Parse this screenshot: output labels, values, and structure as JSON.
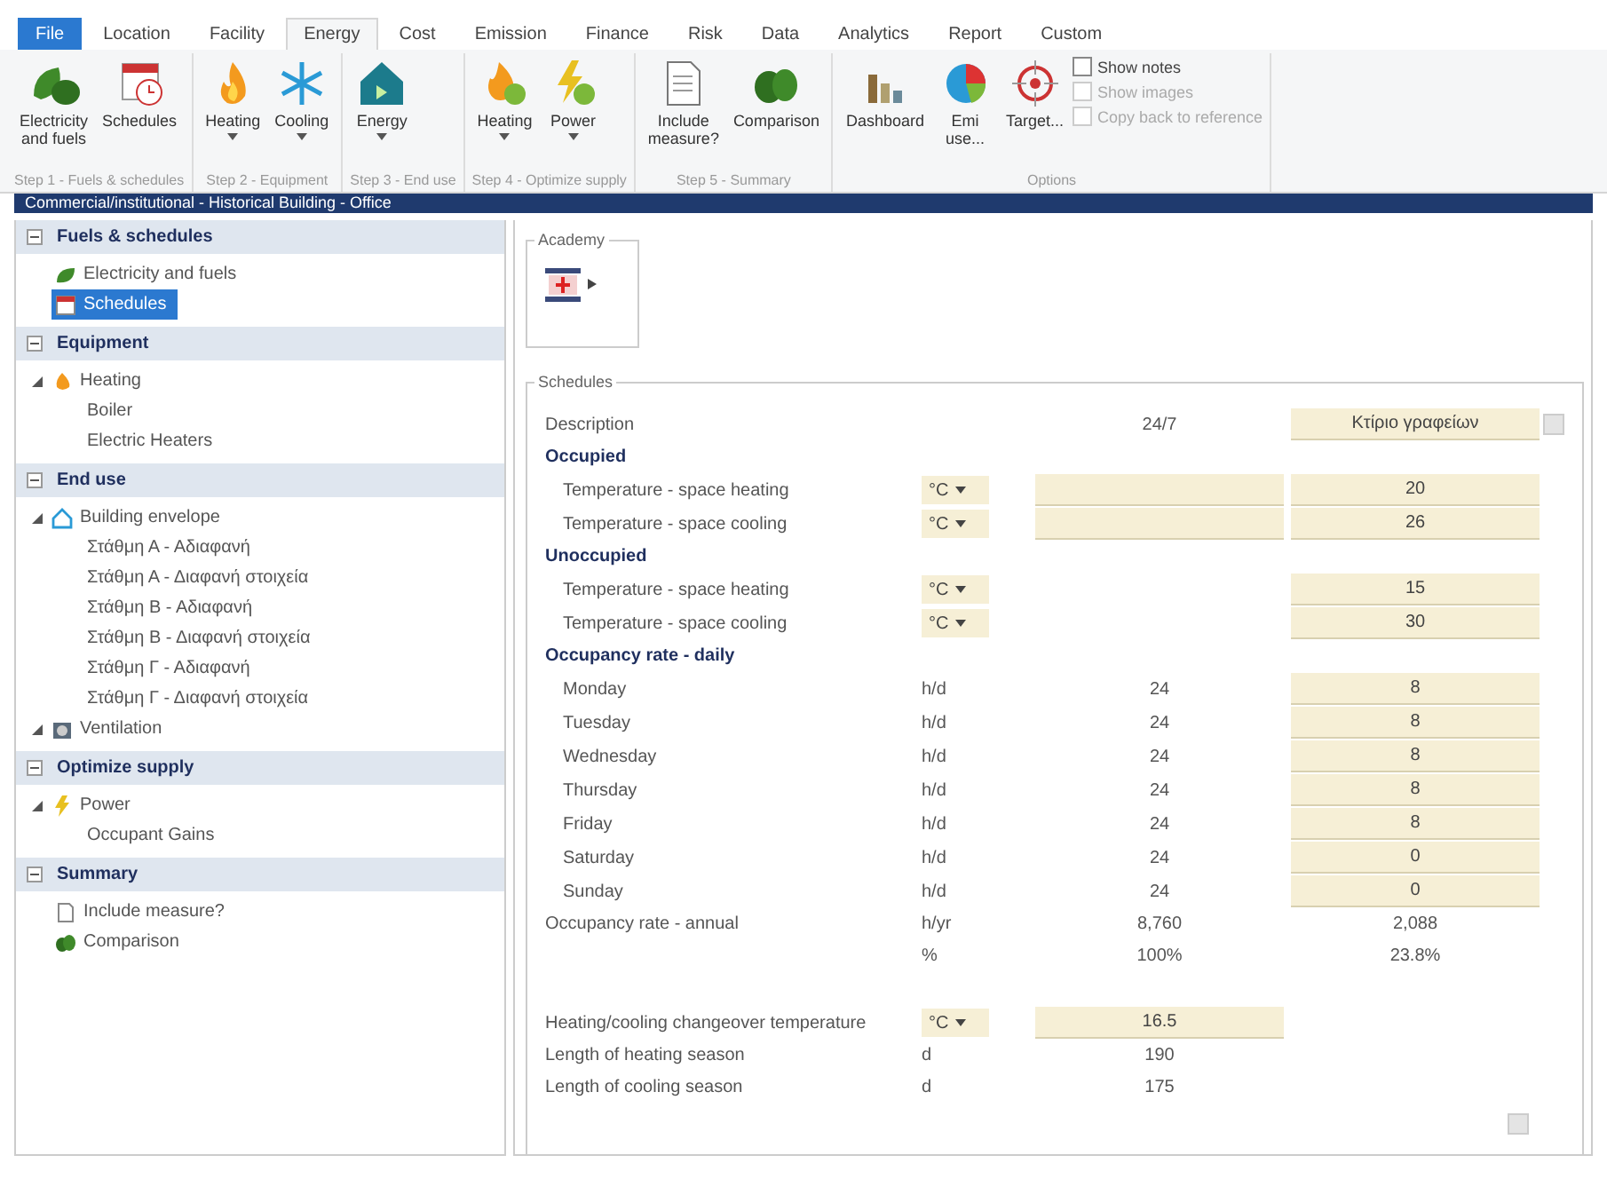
{
  "tabs": [
    {
      "label": "File",
      "selected": false,
      "kind": "file"
    },
    {
      "label": "Location",
      "selected": false,
      "kind": "tab"
    },
    {
      "label": "Facility",
      "selected": false,
      "kind": "tab"
    },
    {
      "label": "Energy",
      "selected": true,
      "kind": "tab"
    },
    {
      "label": "Cost",
      "selected": false,
      "kind": "tab"
    },
    {
      "label": "Emission",
      "selected": false,
      "kind": "tab"
    },
    {
      "label": "Finance",
      "selected": false,
      "kind": "tab"
    },
    {
      "label": "Risk",
      "selected": false,
      "kind": "tab"
    },
    {
      "label": "Data",
      "selected": false,
      "kind": "tab"
    },
    {
      "label": "Analytics",
      "selected": false,
      "kind": "tab"
    },
    {
      "label": "Report",
      "selected": false,
      "kind": "tab"
    },
    {
      "label": "Custom",
      "selected": false,
      "kind": "tab"
    }
  ],
  "ribbon_groups": [
    {
      "label": "Step 1 - Fuels & schedules",
      "buttons": [
        {
          "label": "Electricity and fuels",
          "dropdown": false
        },
        {
          "label": "Schedules",
          "dropdown": false
        }
      ]
    },
    {
      "label": "Step 2 - Equipment",
      "buttons": [
        {
          "label": "Heating",
          "dropdown": true
        },
        {
          "label": "Cooling",
          "dropdown": true
        }
      ]
    },
    {
      "label": "Step 3 - End use",
      "buttons": [
        {
          "label": "Energy",
          "dropdown": true
        }
      ]
    },
    {
      "label": "Step 4 - Optimize supply",
      "buttons": [
        {
          "label": "Heating",
          "dropdown": true
        },
        {
          "label": "Power",
          "dropdown": true
        }
      ]
    },
    {
      "label": "Step 5 - Summary",
      "buttons": [
        {
          "label": "Include measure?",
          "dropdown": false
        },
        {
          "label": "Comparison",
          "dropdown": false
        }
      ]
    },
    {
      "label": "Options",
      "buttons": [
        {
          "label": "Dashboard",
          "dropdown": false
        },
        {
          "label": "Emi use...",
          "dropdown": false
        },
        {
          "label": "Target...",
          "dropdown": false
        }
      ],
      "checks": [
        {
          "label": "Show notes",
          "checked": false,
          "disabled": false
        },
        {
          "label": "Show images",
          "checked": false,
          "disabled": true
        },
        {
          "label": "Copy back to reference",
          "checked": false,
          "disabled": true
        }
      ]
    }
  ],
  "document_title": "Commercial/institutional - Historical Building - Office",
  "sidebar": {
    "sections": [
      {
        "title": "Fuels & schedules",
        "expanded": true,
        "items": [
          {
            "label": "Electricity and fuels",
            "selected": false
          },
          {
            "label": "Schedules",
            "selected": true
          }
        ]
      },
      {
        "title": "Equipment",
        "expanded": true,
        "items": [
          {
            "label": "Heating",
            "selected": false,
            "expanded": true,
            "children": [
              {
                "label": "Boiler",
                "selected": false
              },
              {
                "label": "Electric Heaters",
                "selected": false
              }
            ]
          }
        ]
      },
      {
        "title": "End use",
        "expanded": true,
        "items": [
          {
            "label": "Building envelope",
            "selected": false,
            "expanded": true,
            "children": [
              {
                "label": "Στάθμη Α - Αδιαφανή",
                "selected": false
              },
              {
                "label": "Στάθμη Α - Διαφανή στοιχεία",
                "selected": false
              },
              {
                "label": "Στάθμη Β - Αδιαφανή",
                "selected": false
              },
              {
                "label": "Στάθμη Β - Διαφανή στοιχεία",
                "selected": false
              },
              {
                "label": "Στάθμη Γ - Αδιαφανή",
                "selected": false
              },
              {
                "label": "Στάθμη Γ - Διαφανή στοιχεία",
                "selected": false
              }
            ]
          },
          {
            "label": "Ventilation",
            "selected": false,
            "expanded": true
          }
        ]
      },
      {
        "title": "Optimize supply",
        "expanded": true,
        "items": [
          {
            "label": "Power",
            "selected": false,
            "expanded": true,
            "children": [
              {
                "label": "Occupant Gains",
                "selected": false
              }
            ]
          }
        ]
      },
      {
        "title": "Summary",
        "expanded": true,
        "items": [
          {
            "label": "Include measure?",
            "selected": false
          },
          {
            "label": "Comparison",
            "selected": false
          }
        ]
      }
    ]
  },
  "symbol_group": {
    "label": "Academy"
  },
  "schedules": {
    "label": "Schedules",
    "rows": [
      {
        "kind": "description",
        "label": "Description",
        "reference": "24/7",
        "proposed": "Κτίριο γραφείων"
      },
      {
        "kind": "heading",
        "label": "Occupied"
      },
      {
        "kind": "temp",
        "label": "Temperature - space heating",
        "unit": "°C",
        "reference_field": true,
        "proposed": "20"
      },
      {
        "kind": "temp",
        "label": "Temperature - space cooling",
        "unit": "°C",
        "reference_field": true,
        "proposed": "26"
      },
      {
        "kind": "heading",
        "label": "Unoccupied"
      },
      {
        "kind": "temp",
        "label": "Temperature - space heating",
        "unit": "°C",
        "reference_field": false,
        "proposed": "15"
      },
      {
        "kind": "temp",
        "label": "Temperature - space cooling",
        "unit": "°C",
        "reference_field": false,
        "proposed": "30"
      },
      {
        "kind": "heading",
        "label": "Occupancy rate - daily"
      },
      {
        "kind": "daily",
        "label": "Monday",
        "unit": "h/d",
        "reference": "24",
        "proposed": "8"
      },
      {
        "kind": "daily",
        "label": "Tuesday",
        "unit": "h/d",
        "reference": "24",
        "proposed": "8"
      },
      {
        "kind": "daily",
        "label": "Wednesday",
        "unit": "h/d",
        "reference": "24",
        "proposed": "8"
      },
      {
        "kind": "daily",
        "label": "Thursday",
        "unit": "h/d",
        "reference": "24",
        "proposed": "8"
      },
      {
        "kind": "daily",
        "label": "Friday",
        "unit": "h/d",
        "reference": "24",
        "proposed": "8"
      },
      {
        "kind": "daily",
        "label": "Saturday",
        "unit": "h/d",
        "reference": "24",
        "proposed": "0"
      },
      {
        "kind": "daily",
        "label": "Sunday",
        "unit": "h/d",
        "reference": "24",
        "proposed": "0"
      },
      {
        "kind": "plain",
        "label": "Occupancy rate - annual",
        "unit": "h/yr",
        "reference": "8,760",
        "proposed": "2,088"
      },
      {
        "kind": "plain",
        "unit": "%",
        "reference": "100%",
        "proposed": "23.8%"
      },
      {
        "kind": "spacer"
      },
      {
        "kind": "changeover",
        "label": "Heating/cooling changeover temperature",
        "unit": "°C",
        "reference": "16.5"
      },
      {
        "kind": "plain",
        "label": "Length of heating season",
        "unit": "d",
        "reference": "190"
      },
      {
        "kind": "plain",
        "label": "Length of cooling season",
        "unit": "d",
        "reference": "175"
      }
    ]
  }
}
